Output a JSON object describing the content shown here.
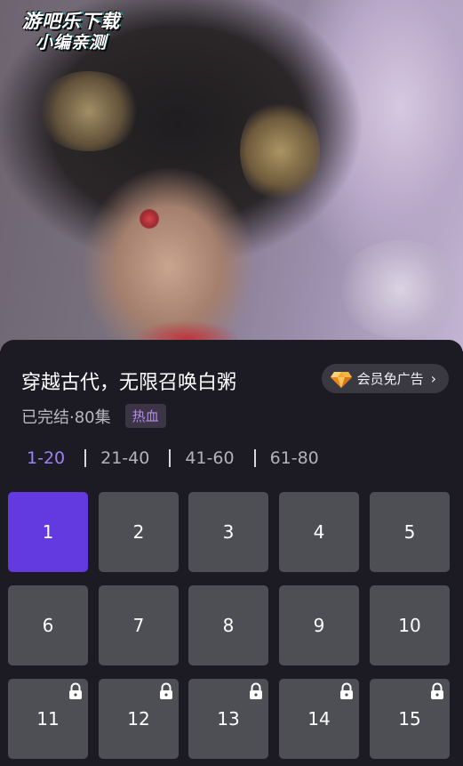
{
  "watermark": {
    "line1": "游吧乐下载",
    "line2": "小编亲测"
  },
  "drama": {
    "title": "穿越古代，无限召唤白粥",
    "status": "已完结·80集",
    "tag": "热血"
  },
  "vip": {
    "label": "会员免广告",
    "icon": "gem-icon",
    "chevron": "›"
  },
  "ranges": [
    {
      "label": "1-20",
      "active": true
    },
    {
      "label": "21-40",
      "active": false
    },
    {
      "label": "41-60",
      "active": false
    },
    {
      "label": "61-80",
      "active": false
    }
  ],
  "episodes": [
    {
      "num": "1",
      "active": true,
      "locked": false
    },
    {
      "num": "2",
      "active": false,
      "locked": false
    },
    {
      "num": "3",
      "active": false,
      "locked": false
    },
    {
      "num": "4",
      "active": false,
      "locked": false
    },
    {
      "num": "5",
      "active": false,
      "locked": false
    },
    {
      "num": "6",
      "active": false,
      "locked": false
    },
    {
      "num": "7",
      "active": false,
      "locked": false
    },
    {
      "num": "8",
      "active": false,
      "locked": false
    },
    {
      "num": "9",
      "active": false,
      "locked": false
    },
    {
      "num": "10",
      "active": false,
      "locked": false
    },
    {
      "num": "11",
      "active": false,
      "locked": true
    },
    {
      "num": "12",
      "active": false,
      "locked": true
    },
    {
      "num": "13",
      "active": false,
      "locked": true
    },
    {
      "num": "14",
      "active": false,
      "locked": true
    },
    {
      "num": "15",
      "active": false,
      "locked": true
    }
  ],
  "colors": {
    "accent": "#6339e0",
    "range_active": "#9a83f2",
    "tag_text": "#b48de8",
    "tile": "#4d4f55",
    "sheet": "#1c1b24"
  }
}
